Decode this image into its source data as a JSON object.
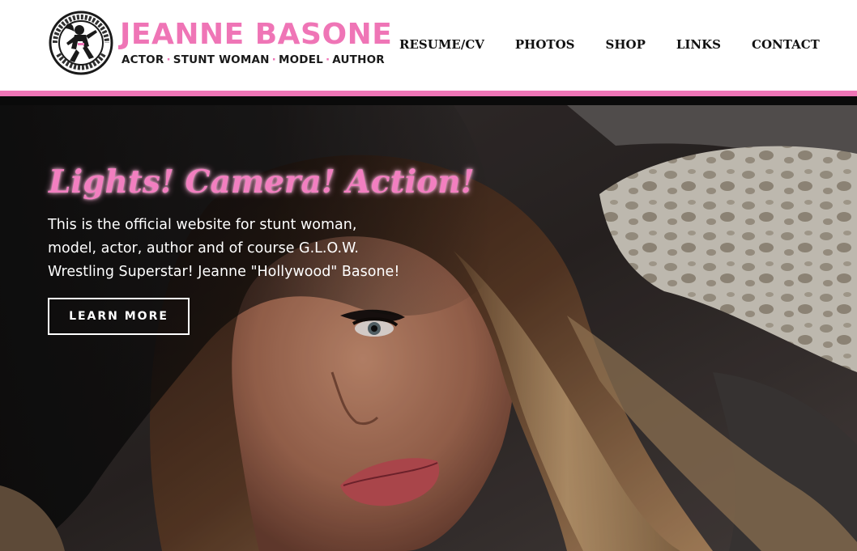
{
  "header": {
    "logo": {
      "name": "JEANNE BASONE",
      "tagline": [
        "ACTOR",
        "STUNT WOMAN",
        "MODEL",
        "AUTHOR"
      ],
      "tagline_separator": "·",
      "emblem_ring_text": "JEANNE BASONE"
    },
    "nav": [
      {
        "label": "RESUME/CV"
      },
      {
        "label": "PHOTOS"
      },
      {
        "label": "SHOP"
      },
      {
        "label": "LINKS"
      },
      {
        "label": "CONTACT"
      }
    ]
  },
  "hero": {
    "heading": "Lights! Camera! Action!",
    "text": "This is the official website for stunt woman, model, actor, author and of course G.L.O.W. Wrestling Superstar! Jeanne \"Hollywood\" Basone!",
    "button_label": "LEARN MORE"
  },
  "colors": {
    "accent_pink": "#ef75b6",
    "header_bg": "#ffffff",
    "nav_text": "#111111",
    "divider_dark": "#0a0a0a",
    "hero_text": "#ffffff"
  }
}
